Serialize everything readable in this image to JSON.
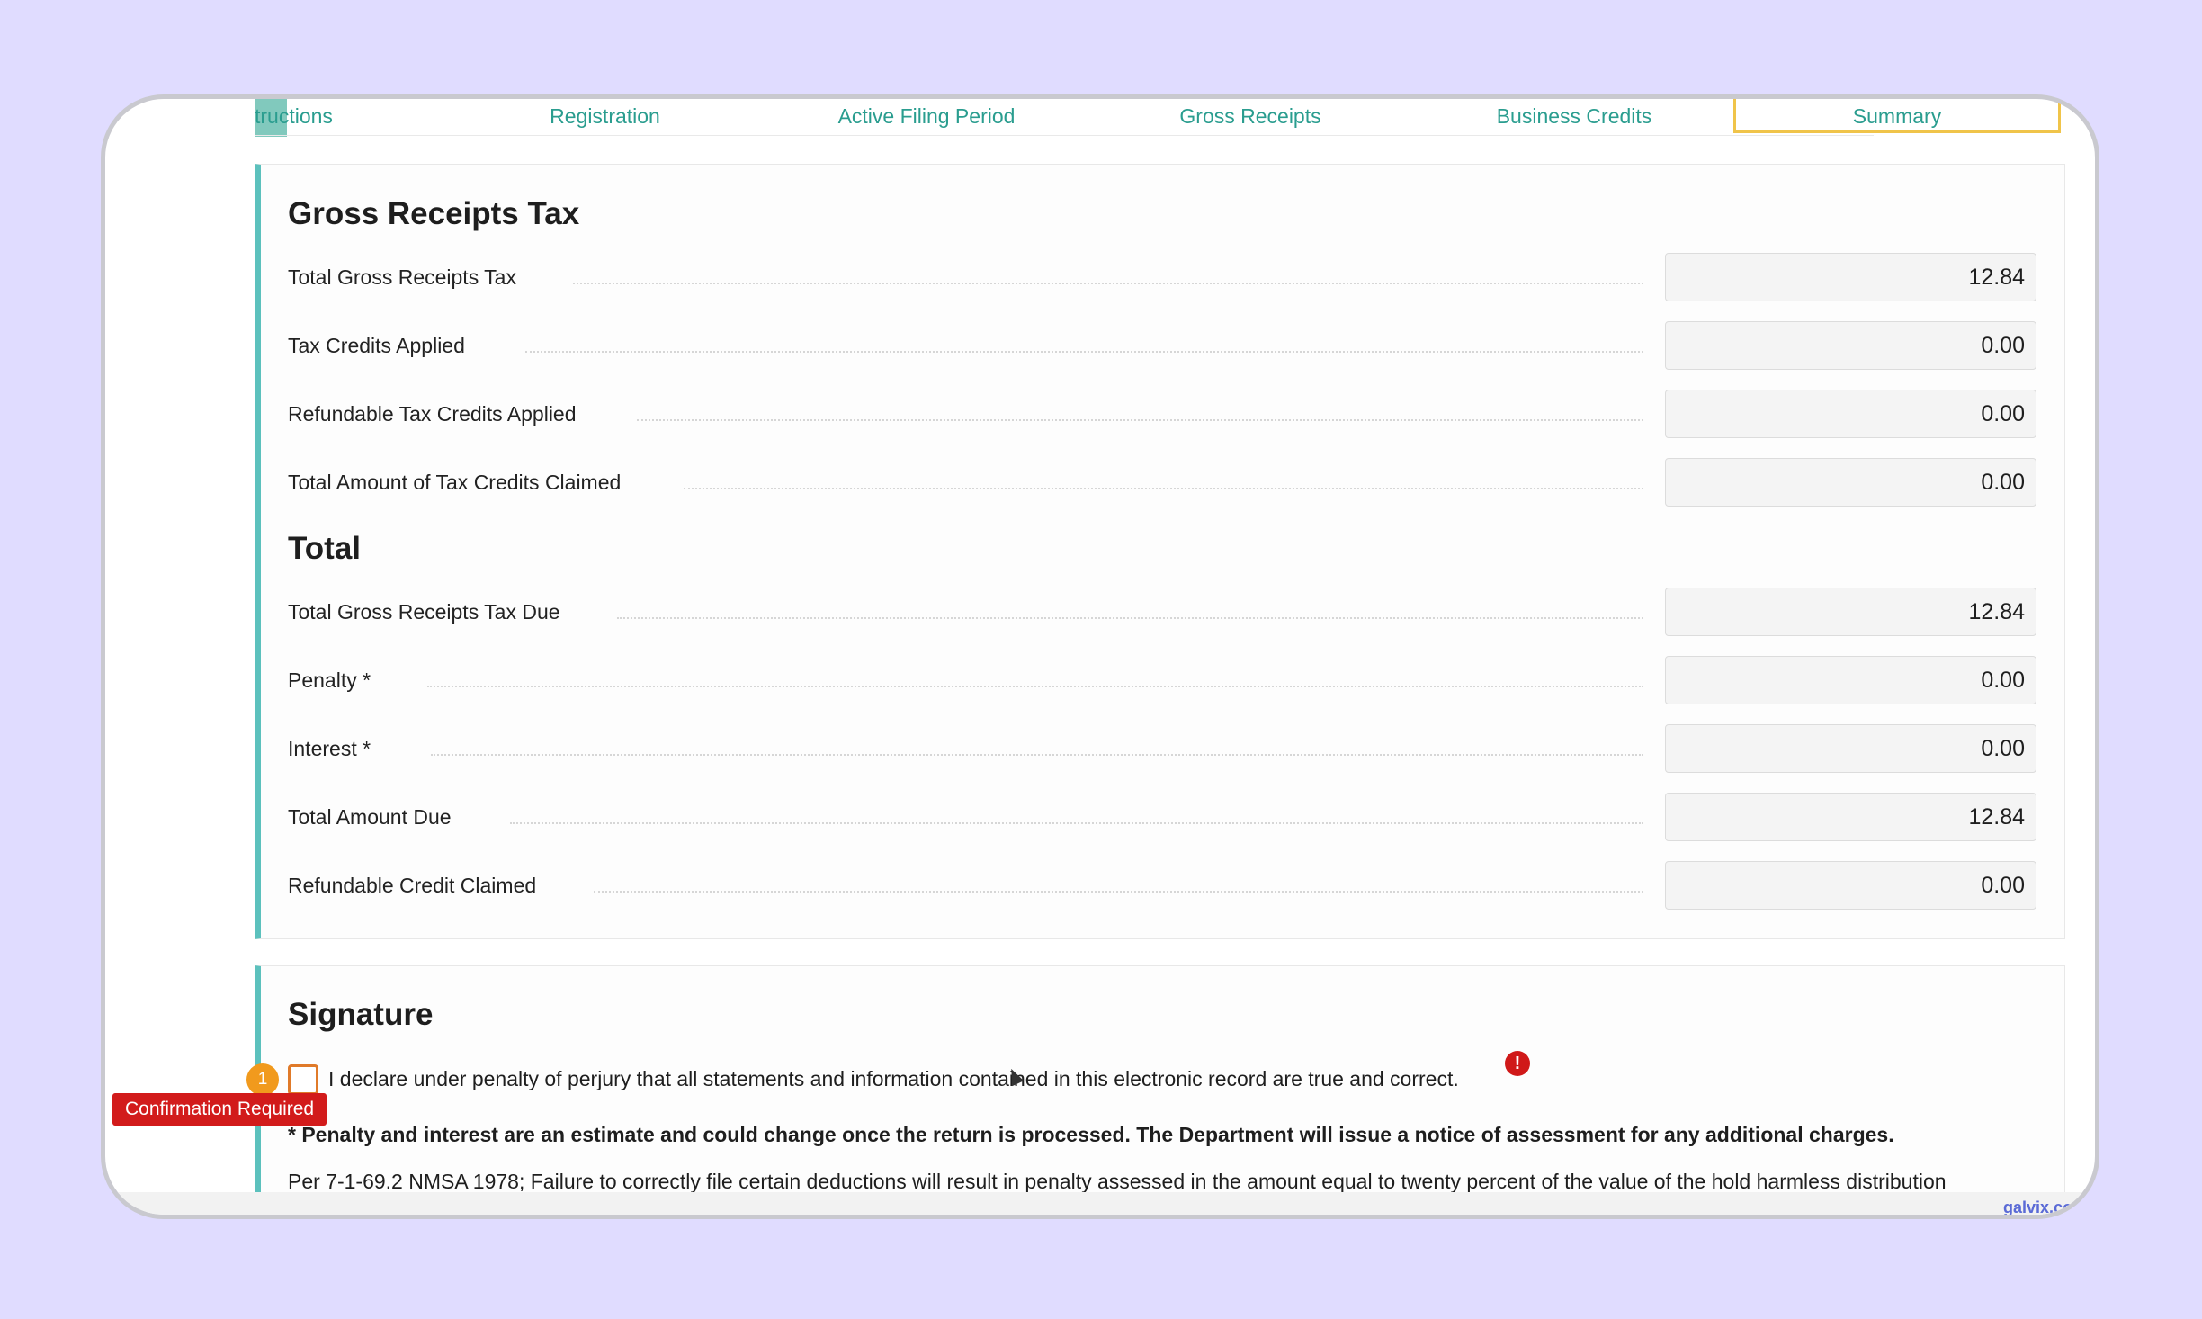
{
  "tabs": [
    {
      "label": "tructions"
    },
    {
      "label": "Registration"
    },
    {
      "label": "Active Filing Period"
    },
    {
      "label": "Gross Receipts"
    },
    {
      "label": "Business Credits"
    },
    {
      "label": "Summary"
    }
  ],
  "gross_receipts_tax": {
    "title": "Gross Receipts Tax",
    "rows": [
      {
        "label": "Total Gross Receipts Tax",
        "value": "12.84"
      },
      {
        "label": "Tax Credits Applied",
        "value": "0.00"
      },
      {
        "label": "Refundable Tax Credits Applied",
        "value": "0.00"
      },
      {
        "label": "Total Amount of Tax Credits Claimed",
        "value": "0.00"
      }
    ]
  },
  "total": {
    "title": "Total",
    "rows": [
      {
        "label": "Total Gross Receipts Tax Due",
        "value": "12.84"
      },
      {
        "label": "Penalty *",
        "value": "0.00"
      },
      {
        "label": "Interest *",
        "value": "0.00"
      },
      {
        "label": "Total Amount Due",
        "value": "12.84"
      },
      {
        "label": "Refundable Credit Claimed",
        "value": "0.00"
      }
    ]
  },
  "signature": {
    "title": "Signature",
    "badge_count": "1",
    "confirmation_tag": "Confirmation Required",
    "declaration": "I declare under penalty of perjury that all statements and information contained in this electronic record are true and correct.",
    "error_icon": "!",
    "note_bold": "* Penalty and interest are an estimate and could change once the return is processed. The Department will issue a notice of assessment for any additional charges.",
    "note_plain": "Per 7-1-69.2 NMSA 1978; Failure to correctly file certain deductions will result in penalty assessed in the amount equal to twenty percent of the value of the hold harmless distribution"
  },
  "watermark": "galvix.co",
  "colors": {
    "accent": "#5cc1bd",
    "tab_text": "#2a9d8f",
    "active_tab_border": "#f0c44a",
    "error": "#d21b1b",
    "badge": "#f19a1d"
  }
}
